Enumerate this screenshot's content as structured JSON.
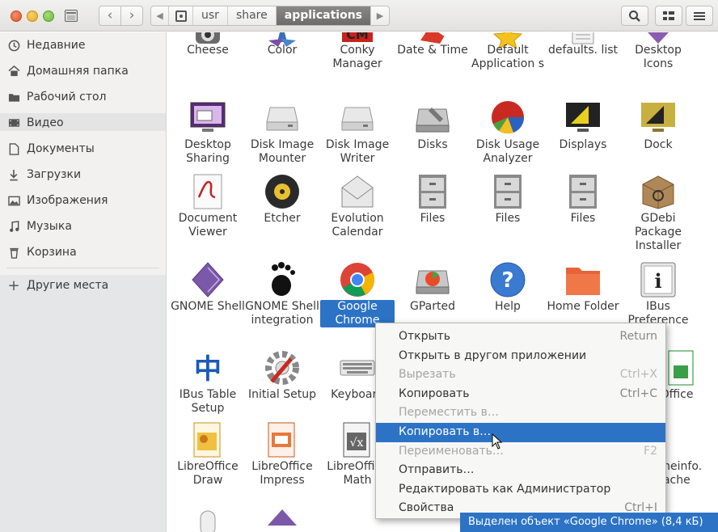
{
  "header": {
    "back_icon": "chevron-left-icon",
    "forward_icon": "chevron-right-icon",
    "breadcrumbs": [
      "usr",
      "share",
      "applications"
    ],
    "search_icon": "search-icon",
    "view_icon": "grid-view-icon",
    "menu_icon": "hamburger-menu-icon"
  },
  "sidebar": {
    "items": [
      {
        "label": "Недавние",
        "icon": "clock-icon"
      },
      {
        "label": "Домашняя папка",
        "icon": "home-icon"
      },
      {
        "label": "Рабочий стол",
        "icon": "desktop-folder-icon"
      },
      {
        "label": "Видео",
        "icon": "video-icon"
      },
      {
        "label": "Документы",
        "icon": "document-icon"
      },
      {
        "label": "Загрузки",
        "icon": "download-icon"
      },
      {
        "label": "Изображения",
        "icon": "image-icon"
      },
      {
        "label": "Музыка",
        "icon": "music-icon"
      },
      {
        "label": "Корзина",
        "icon": "trash-icon"
      }
    ],
    "other_places": "Другие места"
  },
  "apps": [
    {
      "label": "Cheese",
      "icon": "cheese-icon"
    },
    {
      "label": "Color",
      "icon": "color-icon"
    },
    {
      "label": "Conky Manager",
      "icon": "conky-icon"
    },
    {
      "label": "Date & Time",
      "icon": "date-time-icon"
    },
    {
      "label": "Default Application s",
      "icon": "default-apps-icon"
    },
    {
      "label": "defaults. list",
      "icon": "text-file-icon"
    },
    {
      "label": "Desktop Icons",
      "icon": "desktop-icons-icon"
    },
    {
      "label": "Desktop Sharing",
      "icon": "desktop-sharing-icon"
    },
    {
      "label": "Disk Image Mounter",
      "icon": "disk-mounter-icon"
    },
    {
      "label": "Disk Image Writer",
      "icon": "disk-writer-icon"
    },
    {
      "label": "Disks",
      "icon": "disks-icon"
    },
    {
      "label": "Disk Usage Analyzer",
      "icon": "disk-usage-icon"
    },
    {
      "label": "Displays",
      "icon": "displays-icon"
    },
    {
      "label": "Dock",
      "icon": "dock-icon"
    },
    {
      "label": "Document Viewer",
      "icon": "document-viewer-icon"
    },
    {
      "label": "Etcher",
      "icon": "etcher-icon"
    },
    {
      "label": "Evolution Calendar",
      "icon": "evolution-calendar-icon"
    },
    {
      "label": "Files",
      "icon": "files-cabinet-icon"
    },
    {
      "label": "Files",
      "icon": "files-cabinet-icon"
    },
    {
      "label": "Files",
      "icon": "files-cabinet-icon"
    },
    {
      "label": "GDebi Package Installer",
      "icon": "gdebi-icon"
    },
    {
      "label": "GNOME Shell",
      "icon": "gnome-shell-icon"
    },
    {
      "label": "GNOME Shell integration",
      "icon": "gnome-foot-icon"
    },
    {
      "label": "Google Chrome",
      "icon": "chrome-icon"
    },
    {
      "label": "GParted",
      "icon": "gparted-icon"
    },
    {
      "label": "Help",
      "icon": "help-icon"
    },
    {
      "label": "Home Folder",
      "icon": "home-folder-icon"
    },
    {
      "label": "IBus Preference",
      "icon": "ibus-pref-icon"
    },
    {
      "label": "IBus Table Setup",
      "icon": "ibus-table-icon"
    },
    {
      "label": "Initial Setup",
      "icon": "initial-setup-icon"
    },
    {
      "label": "Keyboard",
      "icon": "keyboard-icon"
    },
    {
      "label": "Office",
      "icon": "libreoffice-calc-icon"
    },
    {
      "label": "LibreOffice Draw",
      "icon": "libreoffice-draw-icon"
    },
    {
      "label": "LibreOffice Impress",
      "icon": "libreoffice-impress-icon"
    },
    {
      "label": "LibreOffice Math",
      "icon": "libreoffice-math-icon"
    },
    {
      "label": "mimeinfo. cache",
      "icon": "mimeinfo-icon"
    }
  ],
  "context_menu": {
    "items": [
      {
        "label": "Открыть",
        "accel": "Return",
        "disabled": false
      },
      {
        "label": "Открыть в другом приложении",
        "accel": "",
        "disabled": false
      },
      {
        "label": "Вырезать",
        "accel": "Ctrl+X",
        "disabled": true
      },
      {
        "label": "Копировать",
        "accel": "Ctrl+C",
        "disabled": false
      },
      {
        "label": "Переместить в…",
        "accel": "",
        "disabled": true
      },
      {
        "label": "Копировать в…",
        "accel": "",
        "disabled": false,
        "highlighted": true
      },
      {
        "label": "Переименовать…",
        "accel": "F2",
        "disabled": true
      },
      {
        "label": "Отправить…",
        "accel": "",
        "disabled": false
      },
      {
        "label": "Редактировать как Администратор",
        "accel": "",
        "disabled": false
      },
      {
        "label": "Свойства",
        "accel": "Ctrl+I",
        "disabled": false
      }
    ]
  },
  "status": "Выделен объект «Google Chrome» (8,4 кБ)",
  "colors": {
    "selection": "#2c73c5",
    "sidebar_bg": "#f2f1f0"
  }
}
